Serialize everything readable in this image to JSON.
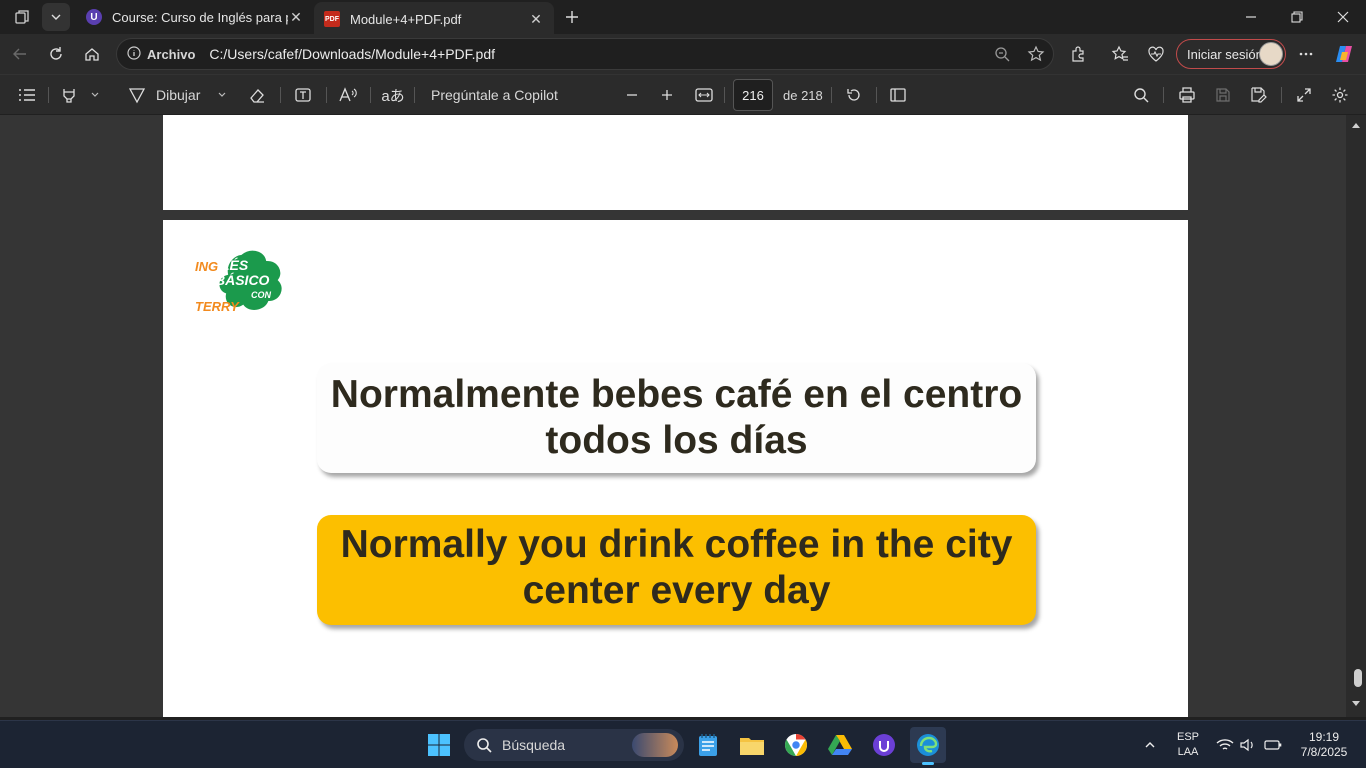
{
  "tabs": [
    {
      "title": "Course: Curso de Inglés para prin",
      "favicon": "udemy-icon"
    },
    {
      "title": "Module+4+PDF.pdf",
      "favicon": "pdf-icon"
    }
  ],
  "address": {
    "site_label": "Archivo",
    "url": "C:/Users/cafef/Downloads/Module+4+PDF.pdf"
  },
  "account": {
    "signin_label": "Iniciar sesión"
  },
  "pdf_toolbar": {
    "draw_label": "Dibujar",
    "copilot_label": "Pregúntale a Copilot",
    "page_current": "216",
    "page_total_label": "de 218"
  },
  "pdf_page": {
    "logo_text": [
      "INGLÉS",
      "BÁSICO",
      "CON",
      "TERRY"
    ],
    "spanish_line1": "Normalmente bebes café en el centro",
    "spanish_line2": "todos los días",
    "english_line1": "Normally you drink coffee in the city",
    "english_line2": "center every day"
  },
  "taskbar": {
    "search_placeholder": "Búsqueda",
    "lang_top": "ESP",
    "lang_bottom": "LAA",
    "time": "19:19",
    "date": "7/8/2025"
  },
  "colors": {
    "accent_yellow": "#fcbf00",
    "logo_green": "#1b9a4c",
    "logo_orange": "#f28a1e"
  }
}
